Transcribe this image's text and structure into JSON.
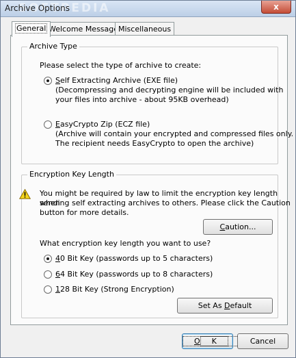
{
  "window": {
    "title": "Archive Options",
    "watermark": "SOFTPEDIA",
    "close_label": "x"
  },
  "tabs": [
    {
      "label": "General",
      "active": true
    },
    {
      "label": "Welcome Message",
      "active": false
    },
    {
      "label": "Miscellaneous",
      "active": false
    }
  ],
  "archive_type": {
    "legend": "Archive Type",
    "prompt": "Please select the type of archive to create:",
    "options": [
      {
        "mnemonic": "S",
        "label_rest": "elf Extracting Archive (EXE file)",
        "description_line1": "(Decompressing and decrypting engine will be included with",
        "description_line2": "your files into archive - about 95KB overhead)",
        "selected": true
      },
      {
        "mnemonic": "E",
        "label_rest": "asyCrypto Zip (ECZ file)",
        "description_line1": "(Archive will contain your encrypted and compressed files only.",
        "description_line2": "The recipient needs EasyCrypto to open the archive)",
        "selected": false
      }
    ]
  },
  "encryption": {
    "legend": "Encryption Key Length",
    "warning_line1": "You might be required by law to limit the encryption key length when",
    "warning_line2": "sending self extracting archives to others. Please click the Caution",
    "warning_line3": "button for more details.",
    "caution_mnemonic": "C",
    "caution_rest": "aution...",
    "question": "What encryption key length you want to use?",
    "options": [
      {
        "mnemonic": "4",
        "label_rest": "0 Bit Key (passwords up to 5 characters)",
        "selected": true
      },
      {
        "mnemonic": "6",
        "label_rest": "4 Bit Key (passwords up to 8 characters)",
        "selected": false
      },
      {
        "mnemonic": "1",
        "label_rest": "28 Bit Key (Strong Encryption)",
        "selected": false
      }
    ],
    "default_prefix": "Set As ",
    "default_mnemonic": "D",
    "default_rest": "efault"
  },
  "footer": {
    "ok_mnemonic": "O",
    "ok_rest": "K",
    "cancel_label": "Cancel"
  },
  "colors": {
    "warning_yellow": "#f5d61b",
    "close_red": "#c44c36"
  }
}
